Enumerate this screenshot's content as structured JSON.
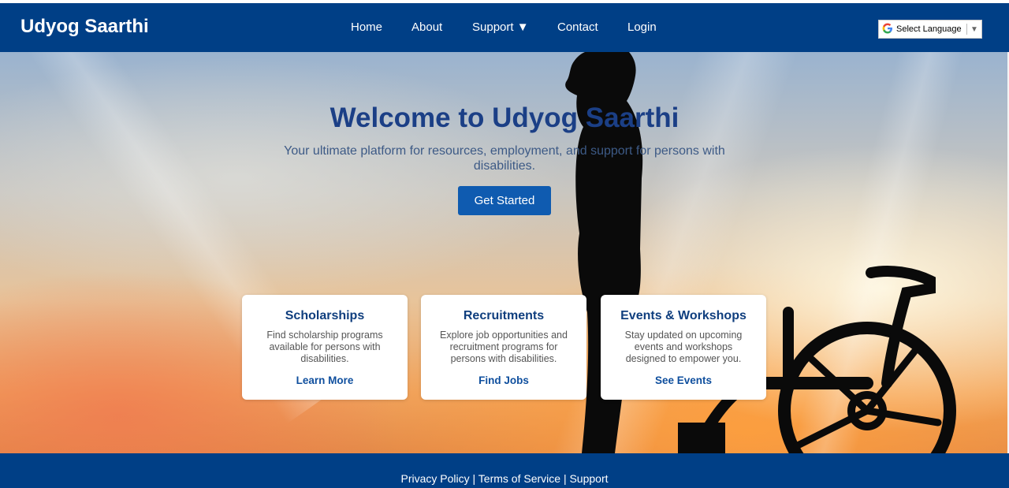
{
  "header": {
    "brand": "Udyog Saarthi",
    "nav": {
      "home": "Home",
      "about": "About",
      "support": "Support ▼",
      "contact": "Contact",
      "login": "Login"
    },
    "language_select": "Select Language",
    "language_arrow": "▼"
  },
  "hero": {
    "title": "Welcome to Udyog Saarthi",
    "subtitle": "Your ultimate platform for resources, employment, and support for persons with disabilities.",
    "cta_label": "Get Started"
  },
  "cards": [
    {
      "title": "Scholarships",
      "description": "Find scholarship programs available for persons with disabilities.",
      "link": "Learn More"
    },
    {
      "title": "Recruitments",
      "description": "Explore job opportunities and recruitment programs for persons with disabilities.",
      "link": "Find Jobs"
    },
    {
      "title": "Events & Workshops",
      "description": "Stay updated on upcoming events and workshops designed to empower you.",
      "link": "See Events"
    }
  ],
  "footer": {
    "privacy": "Privacy Policy",
    "separator": "|",
    "terms": "Terms of Service",
    "support": "Support"
  },
  "colors": {
    "header_bg": "#003f86",
    "accent": "#0f5bb0",
    "title_color": "#1b3f86"
  },
  "icons": [
    "google-translate-icon",
    "chevron-down-icon"
  ]
}
